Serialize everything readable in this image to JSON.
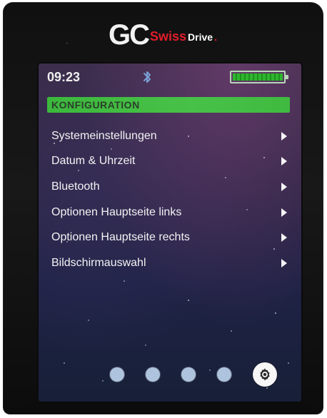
{
  "device": {
    "brand_gc": "GC",
    "brand_swiss": "Swiss",
    "brand_drive": "Drive",
    "brand_dot": "."
  },
  "status_bar": {
    "time": "09:23",
    "bluetooth_icon": "bluetooth-icon",
    "battery_icon": "battery-icon",
    "battery_level": 1.0
  },
  "screen": {
    "title": "KONFIGURATION",
    "menu_items": [
      {
        "label": "Systemeinstellungen"
      },
      {
        "label": "Datum & Uhrzeit"
      },
      {
        "label": "Bluetooth"
      },
      {
        "label": "Optionen Hauptseite links"
      },
      {
        "label": "Optionen Hauptseite rechts"
      },
      {
        "label": "Bildschirmauswahl"
      }
    ],
    "pager": {
      "dots": 4,
      "active_icon": "gear-icon"
    }
  },
  "colors": {
    "accent": "#3cb83c",
    "title_text": "#2b3f2b",
    "menu_text": "#f3f3f3",
    "dot": "#b7cce6",
    "brand_red": "#e31d2b"
  }
}
